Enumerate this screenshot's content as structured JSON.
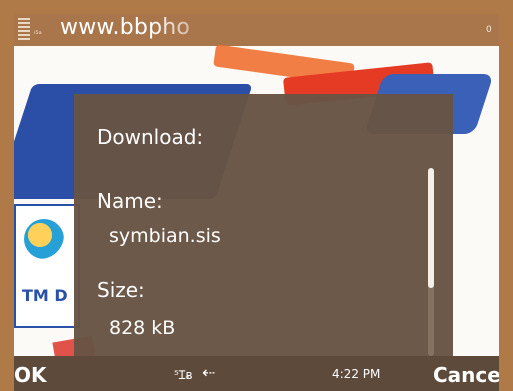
{
  "status_bar": {
    "mini_text": "ᵢ₅ₐ",
    "url": "www.bbpho",
    "right_number": "0"
  },
  "background_page": {
    "card_text": "TM D"
  },
  "dialog": {
    "title": "Download:",
    "name_label": "Name:",
    "name_value": "symbian.sis",
    "size_label": "Size:",
    "size_value": "828 kB"
  },
  "softkeys": {
    "left": "OK",
    "center_icon_1": "⁵Ɪᴃ",
    "center_icon_2": "⇠",
    "time": "4:22 PM",
    "right": "Cancel"
  },
  "colors": {
    "frame": "#b07a48",
    "dialog": "#685444",
    "softbar": "#5e4a3a"
  }
}
